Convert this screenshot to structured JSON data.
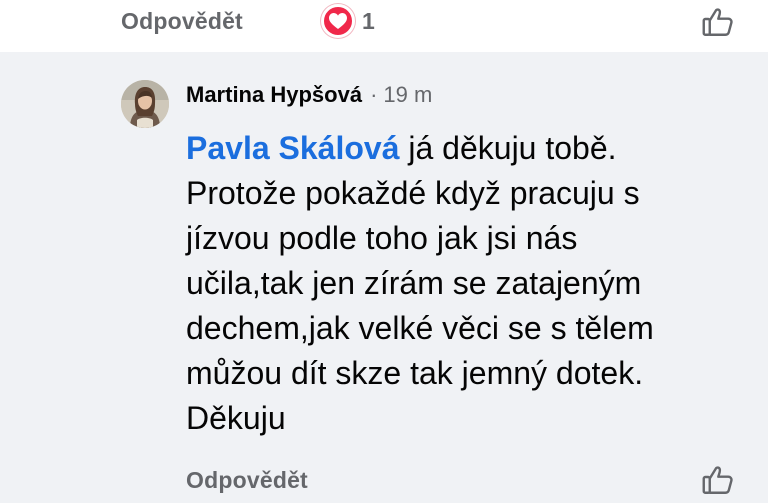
{
  "top": {
    "reply_label": "Odpovědět",
    "reaction_icon": "heart-reaction-icon",
    "reaction_count": "1",
    "like_icon": "thumbs-up-icon"
  },
  "comment": {
    "author": "Martina Hypšová",
    "separator": "·",
    "time": "19 m",
    "mention": "Pavla Skálová",
    "lines": [
      "já děkuju tobě.",
      "Protože pokaždé když pracuju s",
      "jízvou podle toho jak jsi nás",
      "učila,tak jen zírám se zatajeným",
      "dechem,jak velké věci se s tělem",
      "můžou dít skze tak jemný dotek.",
      "Děkuju"
    ],
    "reply_label": "Odpovědět",
    "like_icon": "thumbs-up-icon"
  },
  "colors": {
    "mention": "#1b6ede",
    "secondary_text": "#65676b",
    "panel_bg": "#f0f2f5",
    "heart": "#f0284a"
  }
}
